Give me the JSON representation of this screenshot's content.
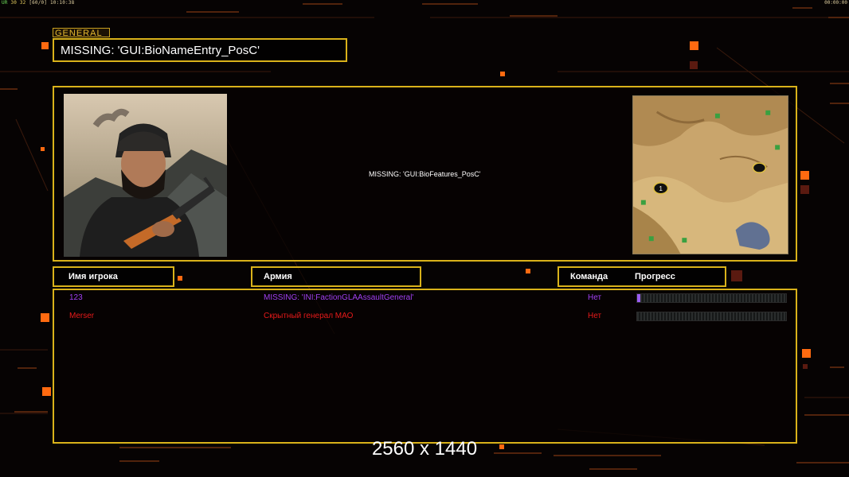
{
  "hud": {
    "top_left": {
      "a": "UR",
      "b": "30",
      "c": "32",
      "d": "[60/0]",
      "time": "10:10:38"
    },
    "top_right": "00:00:00"
  },
  "general_label": "GENERAL",
  "bio_name": "MISSING: 'GUI:BioNameEntry_PosC'",
  "bio_features": "MISSING: 'GUI:BioFeatures_PosC'",
  "minimap": {
    "start_position_label": "1"
  },
  "columns": {
    "player_name": "Имя игрока",
    "army": "Армия",
    "team": "Команда",
    "progress": "Прогресс"
  },
  "players": [
    {
      "name": "123",
      "army": "MISSING: 'INI:FactionGLAAssaultGeneral'",
      "team": "Нет",
      "progress": 0.02,
      "color": "#a040f0",
      "fill_color": "#9a5cf0"
    },
    {
      "name": "Merser",
      "army": "Скрытный генерал МАО",
      "team": "Нет",
      "progress": 0,
      "color": "#e81a1a",
      "fill_color": "#e81a1a"
    }
  ],
  "resolution_label": "2560 x 1440",
  "colors": {
    "panel_border": "#d9b21a",
    "accent_orange": "#ff6a10",
    "background": "#060303"
  }
}
